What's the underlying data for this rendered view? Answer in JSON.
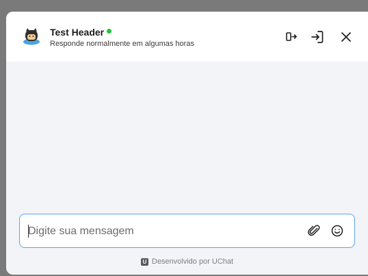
{
  "header": {
    "title": "Test Header",
    "subtitle": "Responde normalmente em algumas horas",
    "status": "online",
    "status_color": "#22c33a",
    "icons": [
      "agent-avatar-icon",
      "detach-window-icon",
      "login-icon",
      "close-icon"
    ]
  },
  "composer": {
    "placeholder": "Digite sua mensagem",
    "value": "",
    "icons": [
      "paperclip-icon",
      "emoji-icon"
    ],
    "focus_color": "#5aa6f0"
  },
  "footer": {
    "brand_letter": "U",
    "text": "Desenvolvido por UChat"
  },
  "colors": {
    "background_overlay": "#7a7a7a",
    "panel": "#f3f4f8",
    "header": "#ffffff"
  }
}
